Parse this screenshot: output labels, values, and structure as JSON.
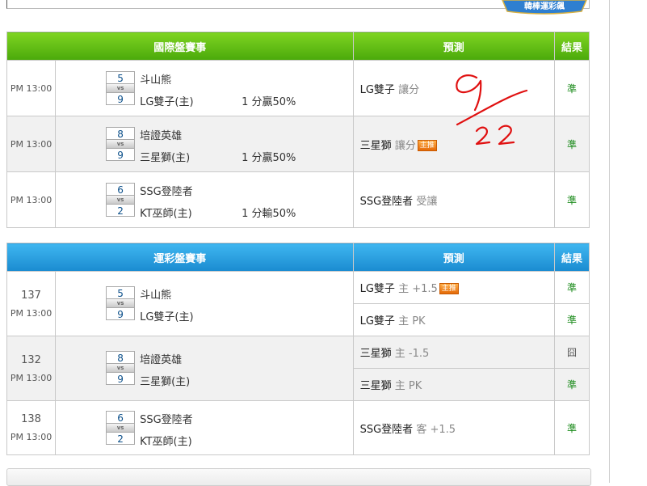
{
  "badge_text": "韓棒運彩飆",
  "section1": {
    "headers": {
      "match": "國際盤賽事",
      "prediction": "預測",
      "result": "結果"
    },
    "rows": [
      {
        "time": "PM 13:00",
        "away_score": "5",
        "vs": "vs",
        "home_score": "9",
        "away_team": "斗山熊",
        "home_team": "LG雙子(主)",
        "odds": "1 分贏50%",
        "pred_team": "LG雙子",
        "pred_note": "讓分",
        "hot": "",
        "result": "準"
      },
      {
        "time": "PM 13:00",
        "away_score": "8",
        "vs": "vs",
        "home_score": "9",
        "away_team": "培證英雄",
        "home_team": "三星獅(主)",
        "odds": "1 分贏50%",
        "pred_team": "三星獅",
        "pred_note": "讓分",
        "hot": "主推",
        "result": "準"
      },
      {
        "time": "PM 13:00",
        "away_score": "6",
        "vs": "vs",
        "home_score": "2",
        "away_team": "SSG登陸者",
        "home_team": "KT巫師(主)",
        "odds": "1 分輸50%",
        "pred_team": "SSG登陸者",
        "pred_note": "受讓",
        "hot": "",
        "result": "準"
      }
    ]
  },
  "section2": {
    "headers": {
      "match": "運彩盤賽事",
      "prediction": "預測",
      "result": "結果"
    },
    "rows": [
      {
        "num": "137",
        "time": "PM 13:00",
        "away_score": "5",
        "vs": "vs",
        "home_score": "9",
        "away_team": "斗山熊",
        "home_team": "LG雙子(主)",
        "preds": [
          {
            "team": "LG雙子",
            "note": "主 +1.5",
            "hot": "主推",
            "result": "準"
          },
          {
            "team": "LG雙子",
            "note": "主 PK",
            "hot": "",
            "result": "準"
          }
        ]
      },
      {
        "num": "132",
        "time": "PM 13:00",
        "away_score": "8",
        "vs": "vs",
        "home_score": "9",
        "away_team": "培證英雄",
        "home_team": "三星獅(主)",
        "preds": [
          {
            "team": "三星獅",
            "note": "主 -1.5",
            "hot": "",
            "result": "囧"
          },
          {
            "team": "三星獅",
            "note": "主 PK",
            "hot": "",
            "result": "準"
          }
        ]
      },
      {
        "num": "138",
        "time": "PM 13:00",
        "away_score": "6",
        "vs": "vs",
        "home_score": "2",
        "away_team": "SSG登陸者",
        "home_team": "KT巫師(主)",
        "preds": [
          {
            "team": "SSG登陸者",
            "note": "客 +1.5",
            "hot": "",
            "result": "準"
          }
        ]
      }
    ]
  },
  "colors": {
    "green_header": "#5cb914",
    "blue_header": "#2aa1e2",
    "correct": "#1a8a1a",
    "handwriting": "#e01010"
  }
}
